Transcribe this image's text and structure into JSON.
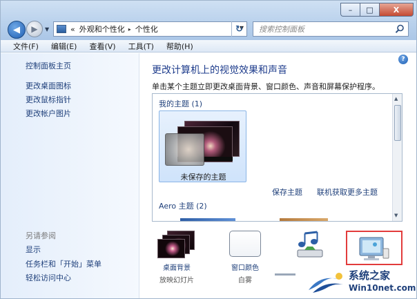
{
  "window": {
    "caption_min": "–",
    "caption_max": "□",
    "caption_close": "X"
  },
  "address": {
    "prefix": "«",
    "segment_1": "外观和个性化",
    "separator": "▸",
    "segment_2": "个性化",
    "icon": "control-panel-icon"
  },
  "search": {
    "placeholder": "搜索控制面板",
    "icon": "search-icon"
  },
  "menu": {
    "file": "文件(F)",
    "edit": "编辑(E)",
    "view": "查看(V)",
    "tools": "工具(T)",
    "help": "帮助(H)"
  },
  "sidebar": {
    "home": "控制面板主页",
    "links": [
      "更改桌面图标",
      "更改鼠标指针",
      "更改帐户图片"
    ],
    "see_also": "另请参阅",
    "see_also_links": [
      "显示",
      "任务栏和「开始」菜单",
      "轻松访问中心"
    ]
  },
  "main": {
    "title": "更改计算机上的视觉效果和声音",
    "description": "单击某个主题立即更改桌面背景、窗口颜色、声音和屏幕保护程序。",
    "help_icon": "?",
    "groups": {
      "mine": "我的主题 (1)",
      "aero": "Aero 主题 (2)"
    },
    "theme_card": "未保存的主题",
    "save_theme": "保存主题",
    "get_more": "联机获取更多主题"
  },
  "settings": {
    "desktop_background": {
      "label": "桌面背景",
      "value": "放映幻灯片"
    },
    "window_color": {
      "label": "窗口颜色",
      "value": "白雾"
    }
  },
  "watermark": {
    "line1": "系统之家",
    "line2": "Win10net.com"
  },
  "colors": {
    "link": "#1e3f7a",
    "title": "#1e3c8c",
    "highlight_frame": "#e23b3b"
  }
}
